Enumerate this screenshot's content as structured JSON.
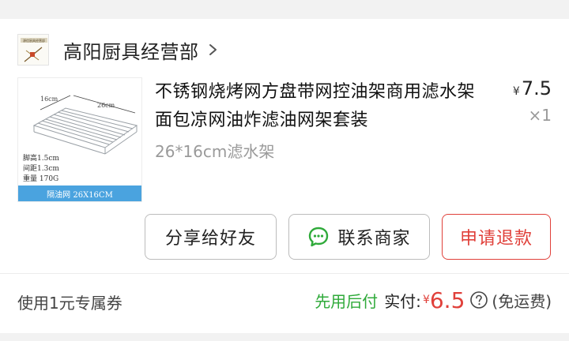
{
  "shop": {
    "name": "高阳厨具经营部",
    "logo_text": "源信厨具经营部"
  },
  "product": {
    "title": "不锈钢烧烤网方盘带网控油架商用滤水架面包凉网油炸滤油网架套装",
    "variant": "26*16cm滤水架",
    "price_currency": "¥",
    "price": "7.5",
    "quantity": "×1",
    "image": {
      "bar_label": "隔油网 26X16CM",
      "dim_width": "16cm",
      "dim_length": "26cm",
      "spec_lines": [
        "脚高1.5cm",
        "间距1.3cm",
        "重量 170G"
      ]
    }
  },
  "actions": {
    "share": "分享给好友",
    "contact": "联系商家",
    "refund": "申请退款"
  },
  "footer": {
    "coupon": "使用1元专属券",
    "pay_later": "先用后付",
    "paid_label": "实付:",
    "paid_currency": "¥",
    "paid_amount": "6.5",
    "shipping": "(免运费)"
  },
  "colors": {
    "accent_red": "#e0403a",
    "accent_green": "#2faa3a",
    "image_bar_blue": "#4aa3df"
  },
  "icons": [
    "chevron-right-icon",
    "chat-bubble-icon",
    "help-circle-icon"
  ]
}
